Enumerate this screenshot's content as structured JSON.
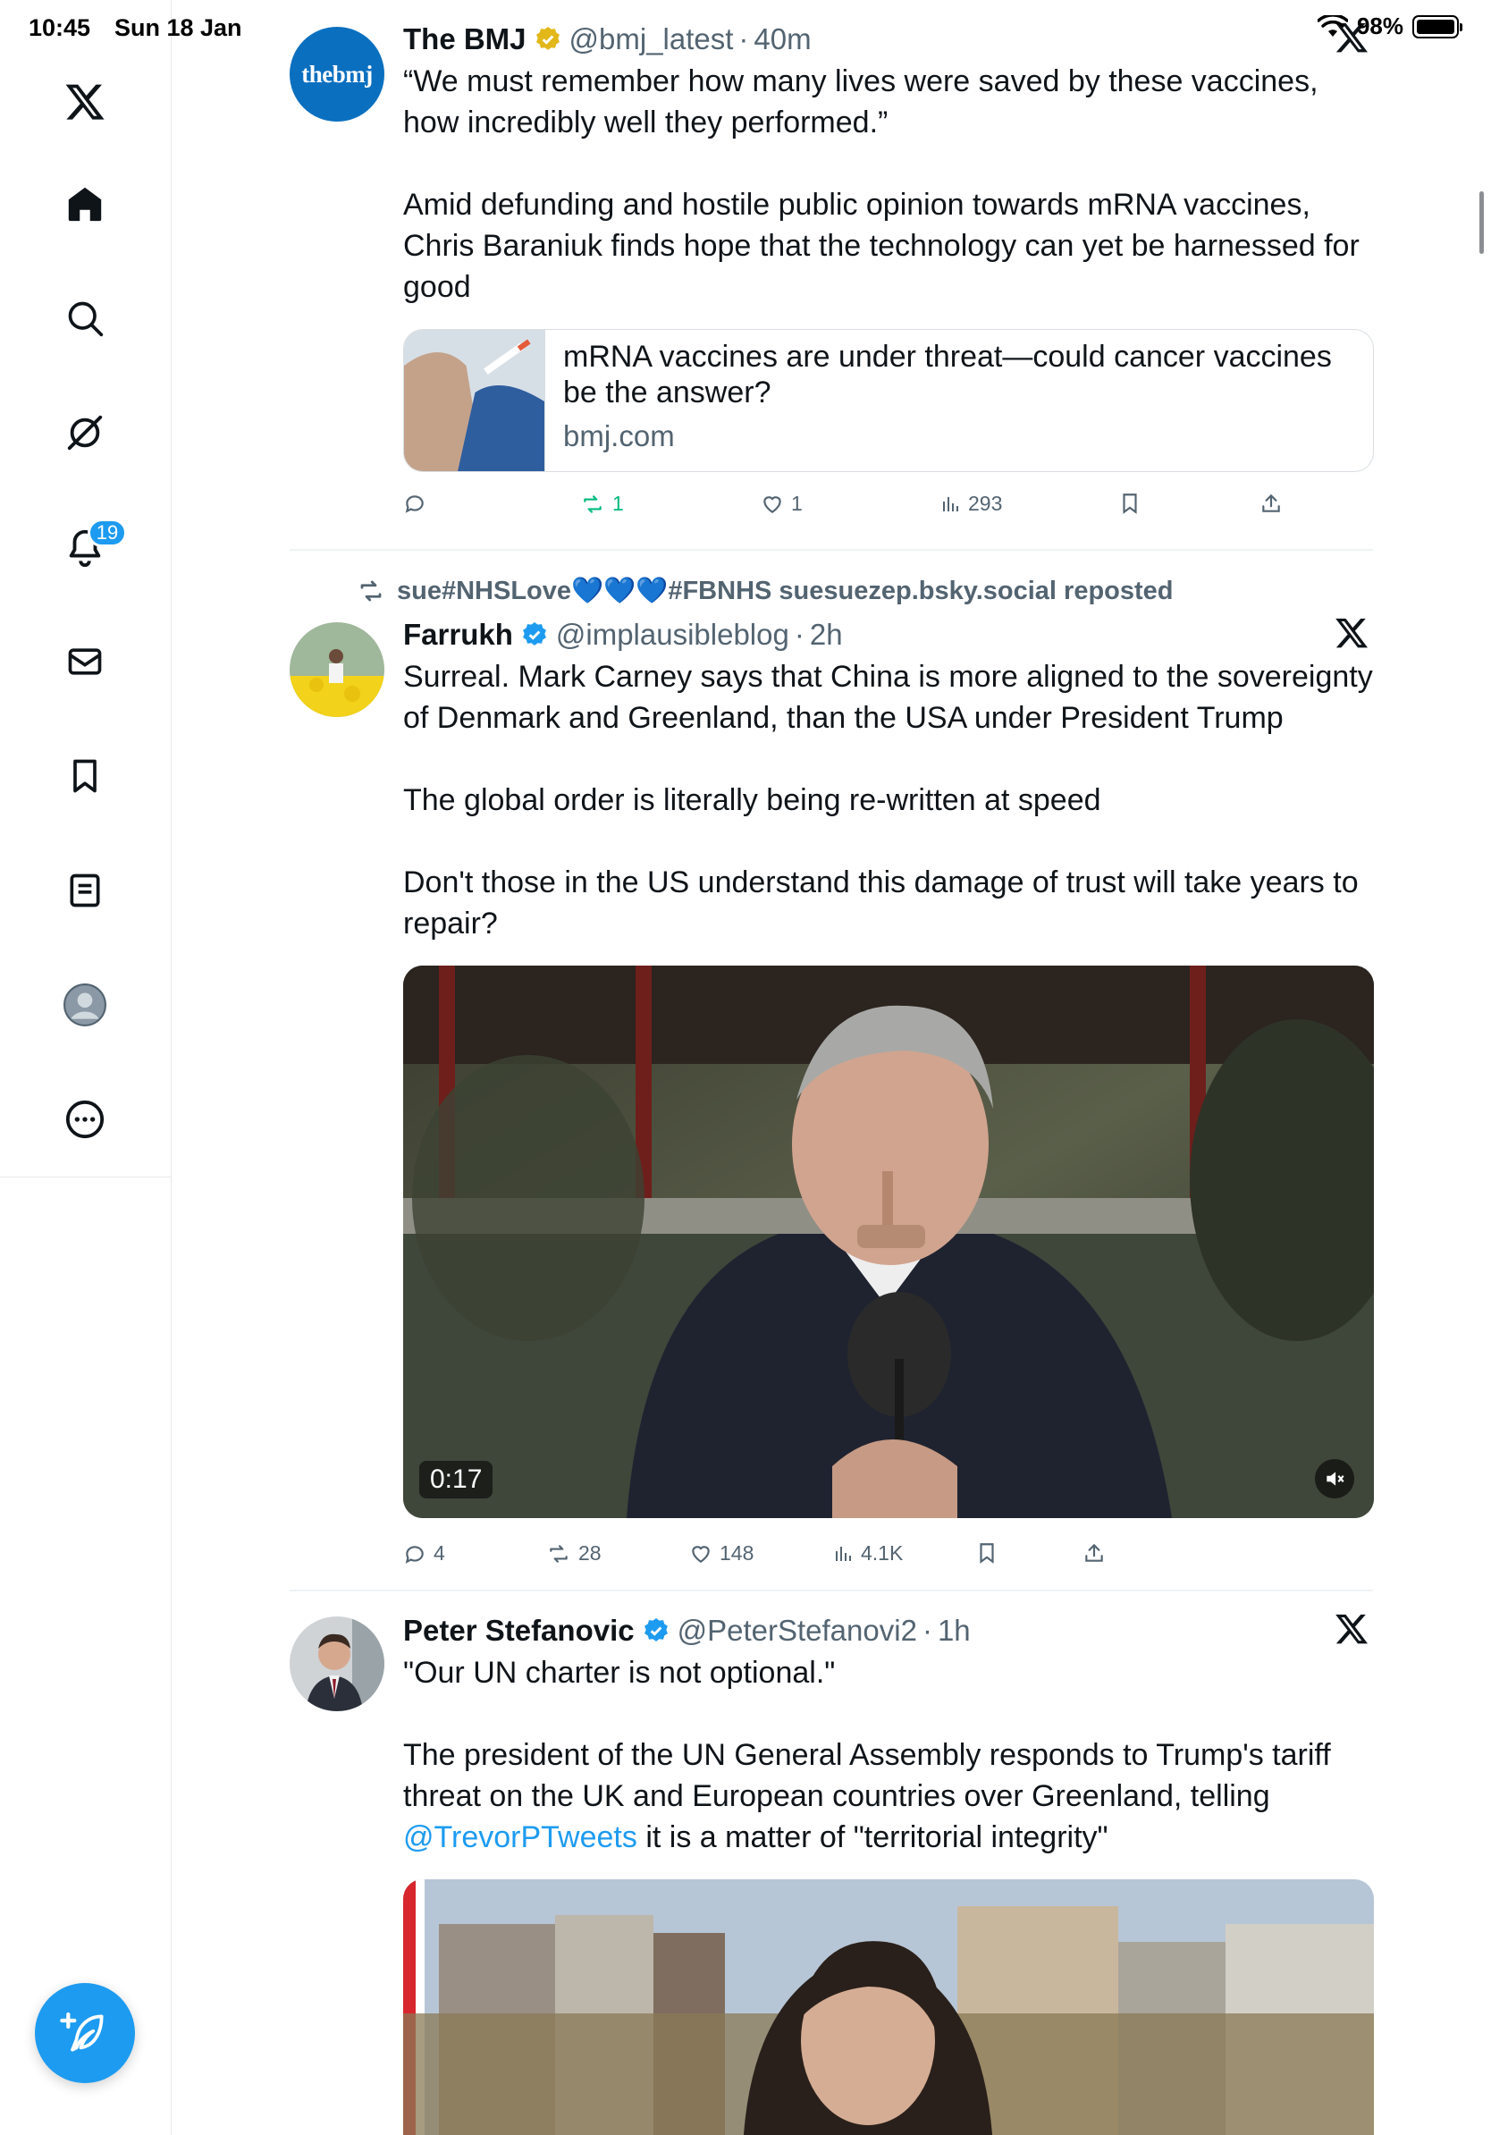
{
  "status_bar": {
    "time": "10:45",
    "date": "Sun 18 Jan",
    "battery": "98%"
  },
  "sidebar": {
    "items": [
      {
        "name": "x-logo"
      },
      {
        "name": "home"
      },
      {
        "name": "search"
      },
      {
        "name": "grok"
      },
      {
        "name": "notifications",
        "badge": "19"
      },
      {
        "name": "messages"
      },
      {
        "name": "bookmarks"
      },
      {
        "name": "lists"
      },
      {
        "name": "profile"
      },
      {
        "name": "more"
      }
    ]
  },
  "tweets": [
    {
      "name": "The BMJ",
      "verified": "gold",
      "handle": "@bmj_latest",
      "time": "40m",
      "text_1": "“We must remember how many lives were saved by these vaccines, how incredibly well they performed.”",
      "text_2": "Amid defunding and hostile public opinion towards mRNA vaccines, Chris Baraniuk finds hope that the technology can yet be harnessed for good",
      "link_card": {
        "title": "mRNA vaccines are under threat—could cancer vaccines be the answer?",
        "domain": "bmj.com"
      },
      "avatar_text": "thebmj",
      "actions": {
        "replies": "",
        "reposts": "1",
        "likes": "1",
        "views": "293"
      }
    },
    {
      "repost_label": "sue#NHSLove💙💙💙#FBNHS suesuezep.bsky.social reposted",
      "name": "Farrukh",
      "verified": "blue",
      "handle": "@implausibleblog",
      "time": "2h",
      "text_1": "Surreal. Mark Carney says that China is more aligned to the sovereignty of Denmark and Greenland, than the USA under President Trump",
      "text_2": "The global order is literally being re-written at speed",
      "text_3": "Don't those in the US understand this damage of trust will take years to repair?",
      "video_time": "0:17",
      "actions": {
        "replies": "4",
        "reposts": "28",
        "likes": "148",
        "views": "4.1K"
      }
    },
    {
      "name": "Peter Stefanovic",
      "verified": "blue",
      "handle": "@PeterStefanovi2",
      "time": "1h",
      "text_1": "\"Our UN charter is not optional.\"",
      "text_2_before": "The president of the UN General Assembly responds to Trump's tariff threat on the UK and European countries over Greenland, telling ",
      "text_2_mention": "@TrevorPTweets",
      "text_2_after": " it is a matter of \"territorial integrity\""
    }
  ],
  "colors": {
    "accent": "#1d9bf0",
    "repost_green": "#00ba7c",
    "secondary_text": "#536471",
    "gold_badge": "#e2b719"
  }
}
